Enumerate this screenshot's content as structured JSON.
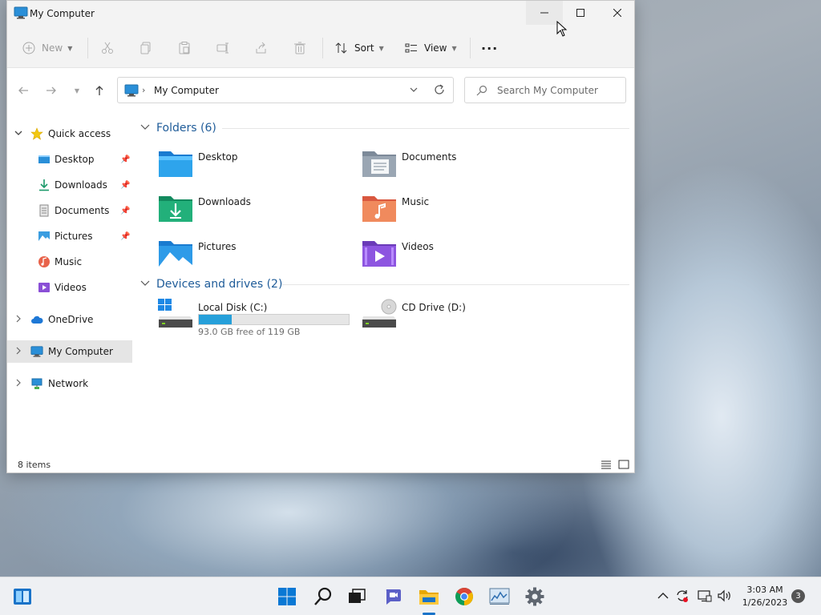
{
  "window": {
    "title": "My Computer"
  },
  "toolbar": {
    "new_label": "New",
    "sort_label": "Sort",
    "view_label": "View",
    "more_label": "···"
  },
  "address": {
    "path": "My Computer",
    "search_placeholder": "Search My Computer"
  },
  "sidebar": {
    "items": [
      {
        "label": "Quick access",
        "icon": "star-icon"
      },
      {
        "label": "Desktop",
        "icon": "desktop-icon",
        "pinned": true
      },
      {
        "label": "Downloads",
        "icon": "download-icon",
        "pinned": true
      },
      {
        "label": "Documents",
        "icon": "document-icon",
        "pinned": true
      },
      {
        "label": "Pictures",
        "icon": "pictures-icon",
        "pinned": true
      },
      {
        "label": "Music",
        "icon": "music-icon"
      },
      {
        "label": "Videos",
        "icon": "video-icon"
      },
      {
        "label": "OneDrive",
        "icon": "cloud-icon"
      },
      {
        "label": "My Computer",
        "icon": "computer-icon",
        "selected": true
      },
      {
        "label": "Network",
        "icon": "network-icon"
      }
    ]
  },
  "main": {
    "folders_header": "Folders (6)",
    "folders": [
      {
        "label": "Desktop"
      },
      {
        "label": "Documents"
      },
      {
        "label": "Downloads"
      },
      {
        "label": "Music"
      },
      {
        "label": "Pictures"
      },
      {
        "label": "Videos"
      }
    ],
    "drives_header": "Devices and drives (2)",
    "drives": [
      {
        "name": "Local Disk (C:)",
        "free_text": "93.0 GB free of 119 GB",
        "used_fraction": 0.218
      },
      {
        "name": "CD Drive (D:)"
      }
    ]
  },
  "status": {
    "count": "8 items"
  },
  "taskbar": {
    "time": "3:03 AM",
    "date": "1/26/2023",
    "notifications": "3"
  },
  "colors": {
    "accent": "#1a73c8",
    "link_blue": "#1f5c99",
    "drive_fill": "#26a0da"
  }
}
